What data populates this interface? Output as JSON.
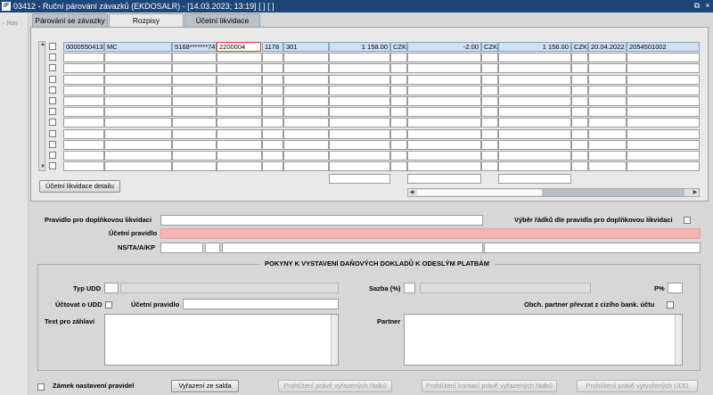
{
  "window": {
    "title": "03412 - Ruční párování závazků (EKDOSALR) - [14.03.2023; 13:19]  [ ]  [ ]",
    "logo": "IF",
    "restore_glyph": "⧉",
    "close_glyph": "×"
  },
  "nav": {
    "label": "Nav"
  },
  "tabs": [
    {
      "label": "Párování se závazky",
      "state": "inactive"
    },
    {
      "label": "Rozpisy",
      "state": "active"
    },
    {
      "label": "Účetní likvidace",
      "state": "inactive"
    }
  ],
  "table": {
    "row_count": 12,
    "first_row": {
      "doc_no": "0000550413",
      "type": "MC",
      "account_masked": "5168*******74",
      "ref": "2200004",
      "code1": "1178",
      "code2": "301",
      "amount1": "1 158.00",
      "currency1": "CZK",
      "amount2": "-2.00",
      "currency2": "CZK",
      "amount3": "1 156.00",
      "currency3": "CZK",
      "date": "20.04.2022",
      "number": "2054501002"
    }
  },
  "buttons": {
    "accounting_detail": "Účetní likvidace detailu",
    "clear_balance": "Vyřazení ze salda",
    "view_excluded_rows": "Prohlížení právě vyřazených řádků",
    "view_excluded_accounts": "Prohlížení kontací právě vyřazených řádků",
    "view_created_udd": "Prohlížení právě vytvořených UDD"
  },
  "form": {
    "rule_label": "Pravidlo pro doplňkovou likvidaci",
    "select_rows_label": "Výběr řádků dle pravidla pro doplňkovou likvidaci",
    "accounting_rule_label": "Účetní pravidlo",
    "ns_label": "NS/TA/A/KP"
  },
  "tax_section": {
    "title": "POKYNY K VYSTAVENÍ DAŇOVÝCH DOKLADŮ K ODESLÝM PLATBÁM",
    "typ_udd": "Typ UDD",
    "sazba": "Sazba (%)",
    "percent": "P%",
    "uctovat": "Účtovat o UDD",
    "ucetni_pravidlo": "Účetní pravidlo",
    "obch_partner": "Obch. partner převzat z cizího bank. účtu",
    "text_header": "Text pro záhlaví",
    "partner": "Partner"
  },
  "footer": {
    "lock_rules": "Zámek nastavení pravidel"
  },
  "colors": {
    "titlebar": "#1d4677",
    "highlight": "#cfe0f4",
    "required": "#f5b5b5"
  }
}
